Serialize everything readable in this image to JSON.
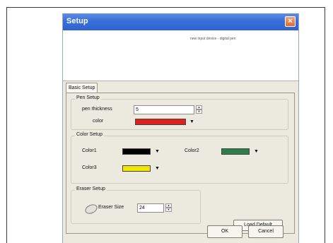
{
  "dialog": {
    "title": "Setup",
    "close_glyph": "×",
    "banner_text": "new input device - digital pen"
  },
  "tabs": [
    "Basic Setup"
  ],
  "pen_setup": {
    "title": "Pen Setup",
    "thickness_label": "pen thickness",
    "thickness_value": "5",
    "color_label": "color",
    "color_value": "#e02020"
  },
  "color_setup": {
    "title": "Color Setup",
    "color1_label": "Color1",
    "color1_value": "#000000",
    "color2_label": "Color2",
    "color2_value": "#2e7d4a",
    "color3_label": "Color3",
    "color3_value": "#f2e600"
  },
  "eraser_setup": {
    "title": "Eraser Setup",
    "size_label": "Eraser Size",
    "size_value": "24"
  },
  "buttons": {
    "load_default": "Load Default",
    "ok": "OK",
    "cancel": "Cancel"
  },
  "icons": {
    "dropdown": "▼",
    "spin_up": "▲",
    "spin_down": "▼"
  }
}
